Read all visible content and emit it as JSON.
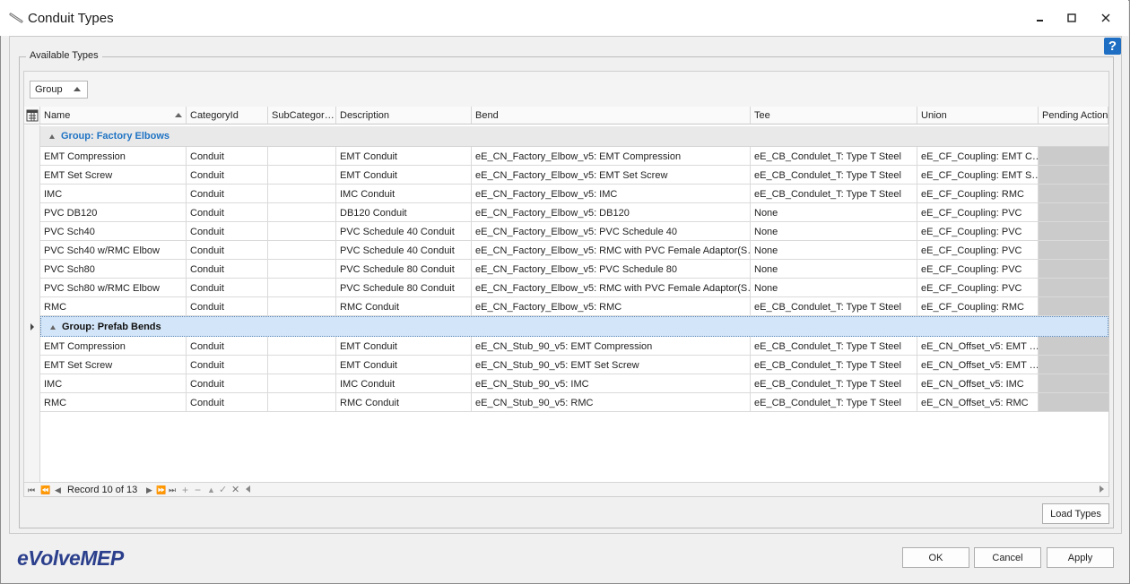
{
  "window": {
    "title": "Conduit Types",
    "icon": "conduit-icon",
    "controls": {
      "minimize": "minimize-icon",
      "maximize": "maximize-icon",
      "close": "close-icon"
    }
  },
  "help": {
    "label": "?"
  },
  "groupbox": {
    "legend": "Available Types"
  },
  "group_panel": {
    "chip_label": "Group"
  },
  "columns": [
    "Name",
    "CategoryId",
    "SubCategor…",
    "Description",
    "Bend",
    "Tee",
    "Union",
    "Pending Action"
  ],
  "groups": [
    {
      "label": "Group: Factory Elbows",
      "color": "#1e73c4",
      "rows": [
        [
          "EMT Compression",
          "Conduit",
          "",
          "EMT Conduit",
          "eE_CN_Factory_Elbow_v5: EMT Compression",
          "eE_CB_Condulet_T: Type T Steel",
          "eE_CF_Coupling: EMT C…",
          ""
        ],
        [
          "EMT Set Screw",
          "Conduit",
          "",
          "EMT Conduit",
          "eE_CN_Factory_Elbow_v5: EMT Set Screw",
          "eE_CB_Condulet_T: Type T Steel",
          "eE_CF_Coupling: EMT S…",
          ""
        ],
        [
          "IMC",
          "Conduit",
          "",
          "IMC Conduit",
          "eE_CN_Factory_Elbow_v5: IMC",
          "eE_CB_Condulet_T: Type T Steel",
          "eE_CF_Coupling: RMC",
          ""
        ],
        [
          "PVC DB120",
          "Conduit",
          "",
          "DB120 Conduit",
          "eE_CN_Factory_Elbow_v5: DB120",
          "None",
          "eE_CF_Coupling: PVC",
          ""
        ],
        [
          "PVC Sch40",
          "Conduit",
          "",
          "PVC Schedule 40 Conduit",
          "eE_CN_Factory_Elbow_v5: PVC Schedule 40",
          "None",
          "eE_CF_Coupling: PVC",
          ""
        ],
        [
          "PVC Sch40 w/RMC Elbow",
          "Conduit",
          "",
          "PVC Schedule 40 Conduit",
          "eE_CN_Factory_Elbow_v5: RMC with PVC Female Adaptor(S…",
          "None",
          "eE_CF_Coupling: PVC",
          ""
        ],
        [
          "PVC Sch80",
          "Conduit",
          "",
          "PVC Schedule 80 Conduit",
          "eE_CN_Factory_Elbow_v5: PVC Schedule 80",
          "None",
          "eE_CF_Coupling: PVC",
          ""
        ],
        [
          "PVC Sch80 w/RMC Elbow",
          "Conduit",
          "",
          "PVC Schedule 80 Conduit",
          "eE_CN_Factory_Elbow_v5: RMC with PVC Female Adaptor(S…",
          "None",
          "eE_CF_Coupling: PVC",
          ""
        ],
        [
          "RMC",
          "Conduit",
          "",
          "RMC Conduit",
          "eE_CN_Factory_Elbow_v5: RMC",
          "eE_CB_Condulet_T: Type T Steel",
          "eE_CF_Coupling: RMC",
          ""
        ]
      ]
    },
    {
      "label": "Group: Prefab Bends",
      "color": "#111111",
      "rows": [
        [
          "EMT Compression",
          "Conduit",
          "",
          "EMT Conduit",
          "eE_CN_Stub_90_v5: EMT Compression",
          "eE_CB_Condulet_T: Type T Steel",
          "eE_CN_Offset_v5: EMT …",
          ""
        ],
        [
          "EMT Set Screw",
          "Conduit",
          "",
          "EMT Conduit",
          "eE_CN_Stub_90_v5: EMT Set Screw",
          "eE_CB_Condulet_T: Type T Steel",
          "eE_CN_Offset_v5: EMT …",
          ""
        ],
        [
          "IMC",
          "Conduit",
          "",
          "IMC Conduit",
          "eE_CN_Stub_90_v5: IMC",
          "eE_CB_Condulet_T: Type T Steel",
          "eE_CN_Offset_v5: IMC",
          ""
        ],
        [
          "RMC",
          "Conduit",
          "",
          "RMC Conduit",
          "eE_CN_Stub_90_v5: RMC",
          "eE_CB_Condulet_T: Type T Steel",
          "eE_CN_Offset_v5: RMC",
          ""
        ]
      ]
    }
  ],
  "navigator": {
    "record_text": "Record 10 of 13"
  },
  "buttons": {
    "load_types": "Load Types",
    "ok": "OK",
    "cancel": "Cancel",
    "apply": "Apply"
  },
  "logo": {
    "text_e": "e",
    "text_volve": "Volve",
    "text_mep": "MEP"
  },
  "colors": {
    "selection": "#d3e5f8",
    "accent": "#1e6fc3",
    "logo": "#2b3f8c",
    "pending": "#cbcbcb"
  }
}
